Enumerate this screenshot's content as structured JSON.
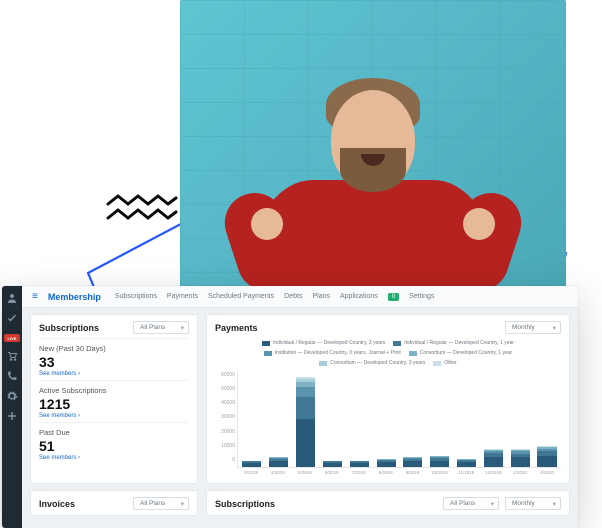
{
  "decor": {
    "photo_alt": "Person in red sweater against turquoise brick wall"
  },
  "app": {
    "brand": "Membership",
    "tabs": [
      "Subscriptions",
      "Payments",
      "Scheduled Payments",
      "Debts",
      "Plans",
      "Applications"
    ],
    "pill_label": "0",
    "settings_label": "Settings"
  },
  "siderail": {
    "icons": [
      "users-icon",
      "check-icon",
      "live-badge",
      "cart-icon",
      "phone-icon",
      "gear-icon",
      "plus-icon"
    ],
    "live_text": "LIVE"
  },
  "subscriptions_card": {
    "title": "Subscriptions",
    "filter": "All Plans",
    "stats": [
      {
        "label": "New (Past 30 Days)",
        "value": "33",
        "link": "See members ›"
      },
      {
        "label": "Active Subscriptions",
        "value": "1215",
        "link": "See members ›"
      },
      {
        "label": "Past Due",
        "value": "51",
        "link": "See members ›"
      }
    ]
  },
  "payments_card": {
    "title": "Payments",
    "filter": "Monthly"
  },
  "chart_data": {
    "type": "bar",
    "title": "",
    "ylabel": "",
    "xlabel": "",
    "ylim": [
      0,
      60000
    ],
    "yticks": [
      60000,
      50000,
      40000,
      30000,
      20000,
      10000,
      0
    ],
    "categories": [
      "3/2019",
      "4/2019",
      "5/2019",
      "6/2019",
      "7/2019",
      "8/2019",
      "9/2019",
      "10/2019",
      "11/2019",
      "12/2019",
      "1/2020",
      "2/2020"
    ],
    "series": [
      {
        "name": "Individual / Regular — Developed Country, 3 years",
        "color": "#2a5a7a"
      },
      {
        "name": "Individual / Regular — Developed Country, 1 year",
        "color": "#3f7795"
      },
      {
        "name": "Institution — Developed Country, 3 years, Journal + Print",
        "color": "#5a93ad"
      },
      {
        "name": "Consortium — Developed Country, 1 year",
        "color": "#7eb2c5"
      },
      {
        "name": "Consortium — Developed Country, 3 years",
        "color": "#a5cddb"
      },
      {
        "name": "Other",
        "color": "#cadfe7"
      }
    ],
    "stacked_totals": [
      4000,
      6000,
      56000,
      4000,
      4000,
      5000,
      6000,
      7000,
      5000,
      11000,
      11000,
      13000
    ],
    "stacked_values": [
      [
        2500,
        1000,
        500,
        0,
        0,
        0
      ],
      [
        3500,
        1500,
        500,
        500,
        0,
        0
      ],
      [
        30000,
        14000,
        6000,
        3000,
        2000,
        1000
      ],
      [
        2500,
        1000,
        500,
        0,
        0,
        0
      ],
      [
        2500,
        1000,
        500,
        0,
        0,
        0
      ],
      [
        3000,
        1200,
        500,
        300,
        0,
        0
      ],
      [
        3500,
        1500,
        600,
        400,
        0,
        0
      ],
      [
        4000,
        1700,
        800,
        500,
        0,
        0
      ],
      [
        3000,
        1200,
        500,
        300,
        0,
        0
      ],
      [
        6000,
        2500,
        1300,
        700,
        400,
        100
      ],
      [
        6000,
        2400,
        1400,
        700,
        400,
        100
      ],
      [
        7000,
        2800,
        1600,
        900,
        500,
        200
      ]
    ]
  },
  "invoices_card": {
    "title": "Invoices",
    "filter": "All Plans"
  },
  "subs2_card": {
    "title": "Subscriptions",
    "filter1": "All Plans",
    "filter2": "Monthly"
  }
}
